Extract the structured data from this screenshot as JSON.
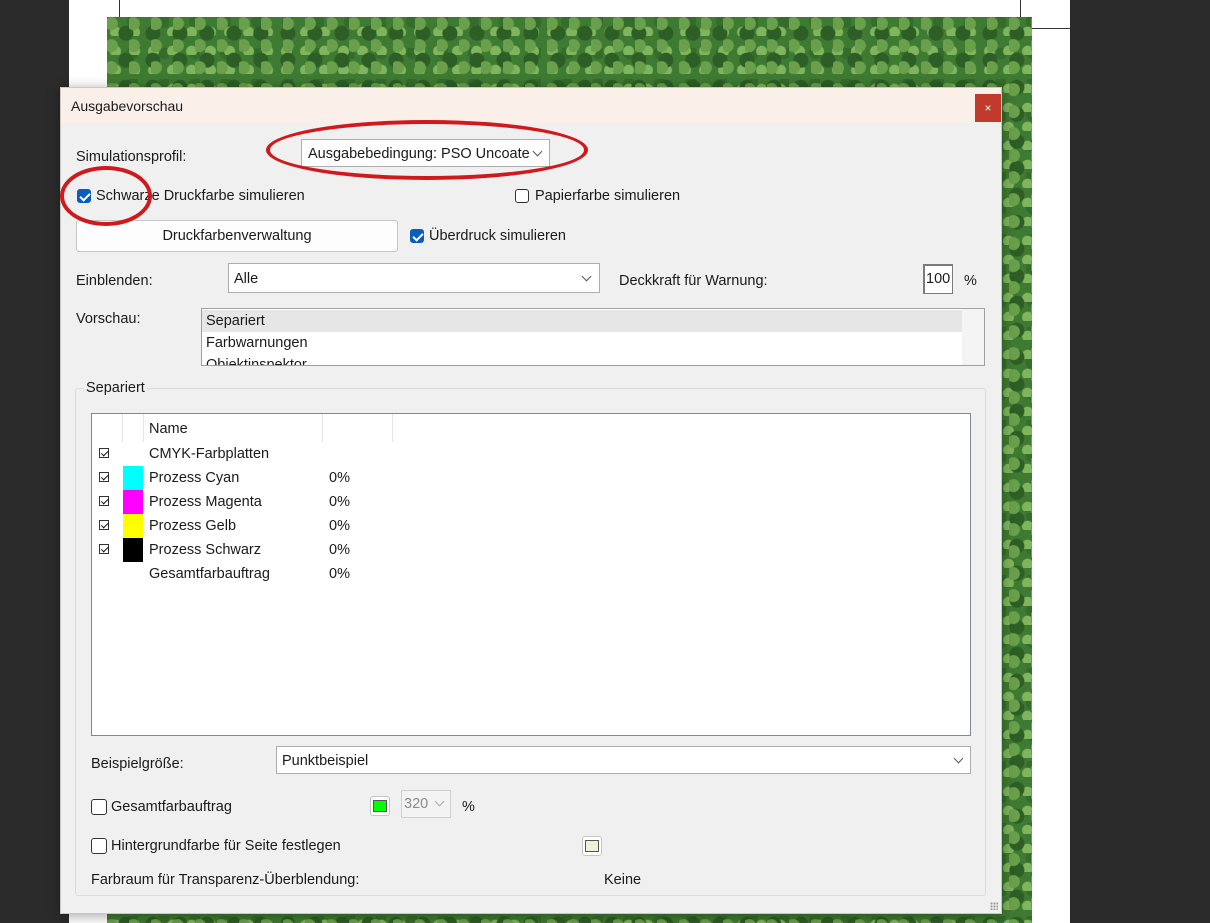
{
  "dialog": {
    "title": "Ausgabevorschau",
    "close_label": "×",
    "simulation_profile_label": "Simulationsprofil:",
    "simulation_profile_value": "Ausgabebedingung: PSO Uncoated",
    "simulate_black_ink": {
      "label": "Schwarze Druckfarbe simulieren",
      "checked": true
    },
    "simulate_paper_color": {
      "label": "Papierfarbe simulieren",
      "checked": false
    },
    "ink_manager_button": "Druckfarbenverwaltung",
    "simulate_overprint": {
      "label": "Überdruck simulieren",
      "checked": true
    },
    "show_label": "Einblenden:",
    "show_value": "Alle",
    "warning_opacity_label": "Deckkraft für Warnung:",
    "warning_opacity_value": "100",
    "warning_opacity_unit": "%",
    "preview_label": "Vorschau:",
    "preview_items": [
      "Separiert",
      "Farbwarnungen",
      "Objektinspektor"
    ],
    "preview_selected": "Separiert",
    "separations_group_title": "Separiert",
    "separations_table": {
      "header_name": "Name",
      "rows": [
        {
          "name": "CMYK-Farbplatten",
          "value": "",
          "checked": true,
          "swatch": ""
        },
        {
          "name": "Prozess Cyan",
          "value": "0%",
          "checked": true,
          "swatch": "#00ffff"
        },
        {
          "name": "Prozess Magenta",
          "value": "0%",
          "checked": true,
          "swatch": "#ff00ff"
        },
        {
          "name": "Prozess Gelb",
          "value": "0%",
          "checked": true,
          "swatch": "#ffff00"
        },
        {
          "name": "Prozess Schwarz",
          "value": "0%",
          "checked": true,
          "swatch": "#000000"
        },
        {
          "name": "Gesamtfarbauftrag",
          "value": "0%",
          "checked": false,
          "swatch": ""
        }
      ]
    },
    "sample_size_label": "Beispielgröße:",
    "sample_size_value": "Punktbeispiel",
    "total_ink": {
      "label": "Gesamtfarbauftrag",
      "checked": false,
      "color": "#00ff00",
      "value": "320",
      "unit": "%"
    },
    "page_bg": {
      "label": "Hintergrundfarbe für Seite festlegen",
      "checked": false,
      "color": "#f0f0d8"
    },
    "blend_space_label": "Farbraum für Transparenz-Überblendung:",
    "blend_space_value": "Keine"
  },
  "colors": {
    "accent": "#0b5cc0",
    "annotation": "#d0191c",
    "close_button": "#c0392b"
  }
}
